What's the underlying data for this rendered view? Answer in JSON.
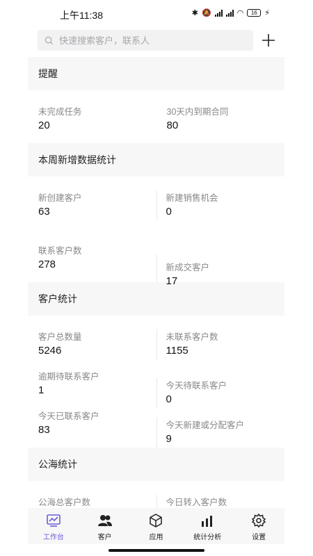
{
  "status_bar": {
    "time": "上午11:38",
    "battery": "16"
  },
  "search": {
    "placeholder": "快速搜索客户，联系人"
  },
  "sections": [
    {
      "title": "提醒",
      "items": [
        {
          "label": "未完成任务",
          "value": "20"
        },
        {
          "label": "30天内到期合同",
          "value": "80"
        }
      ]
    },
    {
      "title": "本周新增数据统计",
      "items": [
        {
          "label": "新创建客户",
          "value": "63"
        },
        {
          "label": "新建销售机会",
          "value": "0"
        },
        {
          "label": "联系客户数",
          "value": "278"
        },
        {
          "label": "新成交客户",
          "value": "17"
        }
      ]
    },
    {
      "title": "客户统计",
      "items": [
        {
          "label": "客户总数量",
          "value": "5246"
        },
        {
          "label": "未联系客户数",
          "value": "1155"
        },
        {
          "label": "逾期待联系客户",
          "value": "1"
        },
        {
          "label": "今天待联系客户",
          "value": "0"
        },
        {
          "label": "今天已联系客户",
          "value": "83"
        },
        {
          "label": "今天新建或分配客户",
          "value": "9"
        }
      ]
    },
    {
      "title": "公海统计",
      "items": [
        {
          "label": "公海总客户数"
        },
        {
          "label": "今日转入客户数"
        }
      ]
    }
  ],
  "tabs": [
    {
      "label": "工作台",
      "icon": "dashboard-icon",
      "active": true
    },
    {
      "label": "客户",
      "icon": "users-icon"
    },
    {
      "label": "应用",
      "icon": "cube-icon"
    },
    {
      "label": "统计分析",
      "icon": "chart-icon"
    },
    {
      "label": "设置",
      "icon": "gear-icon"
    }
  ],
  "colors": {
    "accent": "#6a5cd6",
    "section_bg": "#f7f7f8"
  }
}
